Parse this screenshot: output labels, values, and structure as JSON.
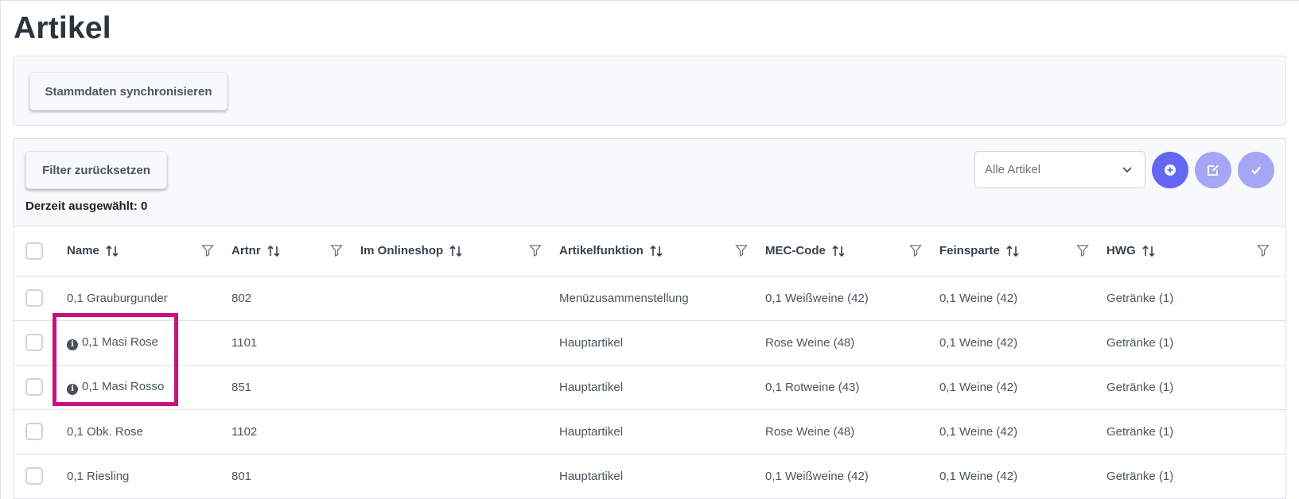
{
  "page": {
    "title": "Artikel"
  },
  "top_panel": {
    "sync_button": "Stammdaten synchronisieren"
  },
  "toolbar": {
    "reset_filter_button": "Filter zurücksetzen",
    "selected_count": "Derzeit ausgewählt: 0",
    "article_select": {
      "value": "Alle Artikel"
    },
    "add_icon": "plus-circle-icon",
    "edit_icon": "edit-icon",
    "check_icon": "check-icon"
  },
  "table": {
    "columns": [
      "Name",
      "Artnr",
      "Im Onlineshop",
      "Artikelfunktion",
      "MEC-Code",
      "Feinsparte",
      "HWG"
    ],
    "rows": [
      {
        "info": false,
        "name": "0,1 Grauburgunder",
        "artnr": "802",
        "onlineshop": "",
        "funktion": "Menüzusammenstellung",
        "mec": "0,1 Weißweine (42)",
        "feinsparte": "0,1 Weine (42)",
        "hwg": "Getränke (1)"
      },
      {
        "info": true,
        "name": "0,1 Masi Rose",
        "artnr": "1101",
        "onlineshop": "",
        "funktion": "Hauptartikel",
        "mec": "Rose Weine (48)",
        "feinsparte": "0,1 Weine (42)",
        "hwg": "Getränke (1)"
      },
      {
        "info": true,
        "name": "0,1 Masi Rosso",
        "artnr": "851",
        "onlineshop": "",
        "funktion": "Hauptartikel",
        "mec": "0,1 Rotweine (43)",
        "feinsparte": "0,1 Weine (42)",
        "hwg": "Getränke (1)"
      },
      {
        "info": false,
        "name": "0,1 Obk. Rose",
        "artnr": "1102",
        "onlineshop": "",
        "funktion": "Hauptartikel",
        "mec": "Rose Weine (48)",
        "feinsparte": "0,1 Weine (42)",
        "hwg": "Getränke (1)"
      },
      {
        "info": false,
        "name": "0,1 Riesling",
        "artnr": "801",
        "onlineshop": "",
        "funktion": "Hauptartikel",
        "mec": "0,1 Weißweine (42)",
        "feinsparte": "0,1 Weine (42)",
        "hwg": "Getränke (1)"
      }
    ]
  },
  "colors": {
    "primary": "#6366f1",
    "primary_light": "#a5a6f6",
    "highlight": "#c8117a"
  }
}
